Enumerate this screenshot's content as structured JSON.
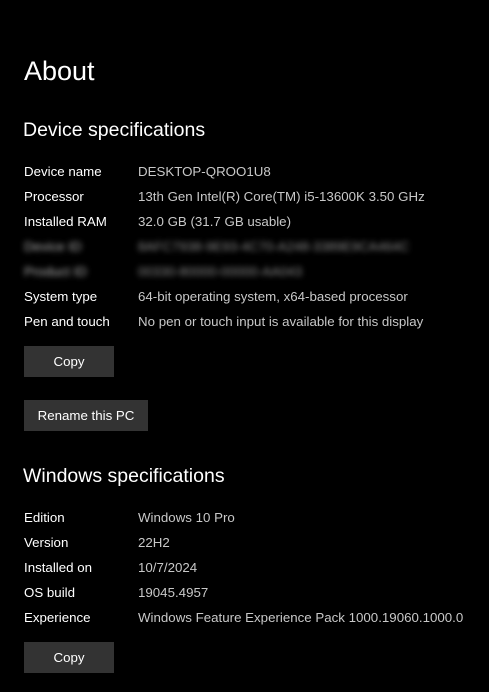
{
  "page": {
    "title": "About"
  },
  "device": {
    "title": "Device specifications",
    "specs": [
      {
        "label": "Device name",
        "value": "DESKTOP-QROO1U8"
      },
      {
        "label": "Processor",
        "value": "13th Gen Intel(R) Core(TM) i5-13600K   3.50 GHz"
      },
      {
        "label": "Installed RAM",
        "value": "32.0 GB (31.7 GB usable)"
      },
      {
        "label": "Device ID",
        "value": "8AFC7938-9E93-4C70-A248-3389E9CA464C"
      },
      {
        "label": "Product ID",
        "value": "00330-80000-00000-AA043"
      },
      {
        "label": "System type",
        "value": "64-bit operating system, x64-based processor"
      },
      {
        "label": "Pen and touch",
        "value": "No pen or touch input is available for this display"
      }
    ],
    "copy_label": "Copy",
    "rename_label": "Rename this PC"
  },
  "windows": {
    "title": "Windows specifications",
    "specs": [
      {
        "label": "Edition",
        "value": "Windows 10 Pro"
      },
      {
        "label": "Version",
        "value": "22H2"
      },
      {
        "label": "Installed on",
        "value": "10/7/2024"
      },
      {
        "label": "OS build",
        "value": "19045.4957"
      },
      {
        "label": "Experience",
        "value": "Windows Feature Experience Pack 1000.19060.1000.0"
      }
    ],
    "copy_label": "Copy"
  },
  "colors": {
    "background": "#000000",
    "label_text": "#ffffff",
    "value_text": "#c8c8c8",
    "button_bg": "#333333"
  }
}
